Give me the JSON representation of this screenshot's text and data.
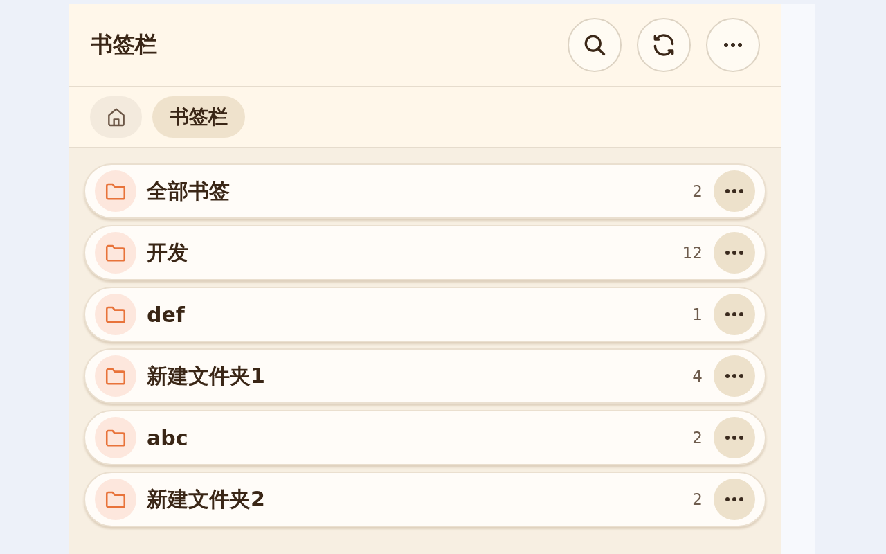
{
  "header": {
    "title": "书签栏"
  },
  "breadcrumbs": [
    {
      "kind": "home",
      "selected": false
    },
    {
      "kind": "folder",
      "label": "书签栏",
      "selected": true
    }
  ],
  "folders": [
    {
      "name": "全部书签",
      "count": "2"
    },
    {
      "name": "开发",
      "count": "12"
    },
    {
      "name": "def",
      "count": "1"
    },
    {
      "name": "新建文件夹1",
      "count": "4"
    },
    {
      "name": "abc",
      "count": "2"
    },
    {
      "name": "新建文件夹2",
      "count": "2"
    }
  ]
}
